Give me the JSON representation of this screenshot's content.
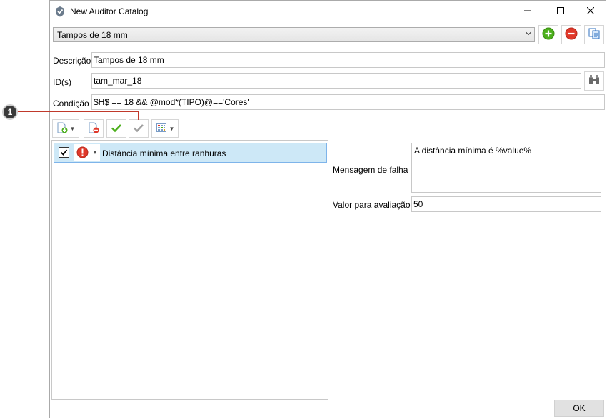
{
  "window": {
    "title": "New Auditor Catalog",
    "minimize_icon": "minimize-icon",
    "maximize_icon": "maximize-icon",
    "close_icon": "close-icon"
  },
  "catalog": {
    "selected": "Tampos de 18 mm",
    "add_icon": "add-green-icon",
    "remove_icon": "remove-red-icon",
    "copy_icon": "copy-icon"
  },
  "form": {
    "descricao_label": "Descrição",
    "descricao_value": "Tampos de 18 mm",
    "ids_label": "ID(s)",
    "ids_value": "tam_mar_18",
    "condicao_label": "Condição",
    "condicao_value": "$H$ == 18 && @mod*(TIPO)@=='Cores'"
  },
  "callout": {
    "number": "1"
  },
  "toolbar": {
    "icons": [
      "add-rule-icon",
      "remove-rule-icon",
      "check-all-icon",
      "uncheck-all-icon",
      "grid-options-icon"
    ]
  },
  "rules": [
    {
      "checked": true,
      "severity": "error",
      "label": "Distância mínima entre ranhuras"
    }
  ],
  "details": {
    "mensagem_label": "Mensagem de falha",
    "mensagem_value": "A distância mínima é %value%",
    "valor_label": "Valor para avaliação",
    "valor_value": "50"
  },
  "footer": {
    "ok_label": "OK"
  },
  "colors": {
    "accent_red": "#c0392b",
    "selection_bg": "#cde8f7",
    "selection_border": "#7eb4ea",
    "green": "#4caf1c",
    "red": "#e0382a"
  }
}
